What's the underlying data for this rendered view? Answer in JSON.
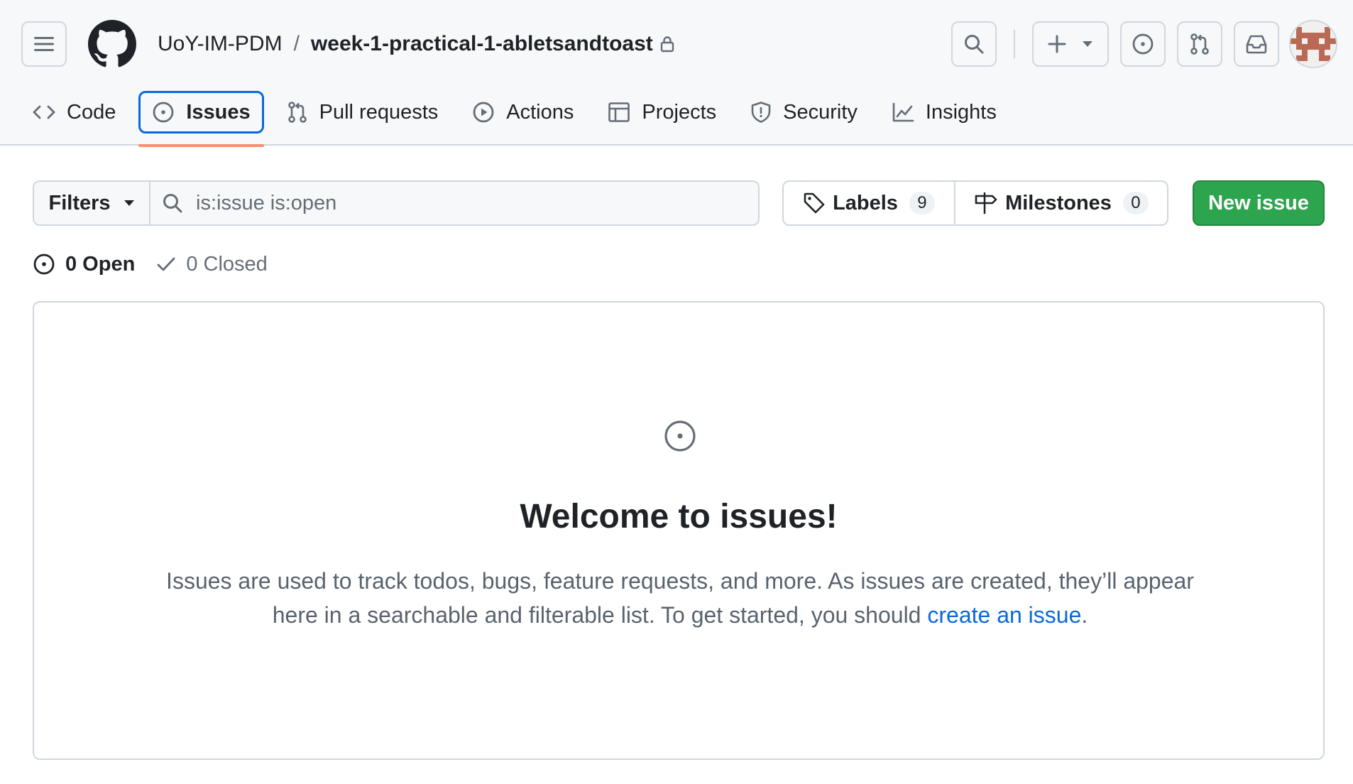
{
  "header": {
    "owner": "UoY-IM-PDM",
    "separator": "/",
    "repo": "week-1-practical-1-abletsandtoast"
  },
  "tabs": [
    {
      "label": "Code",
      "icon": "code-icon"
    },
    {
      "label": "Issues",
      "icon": "issue-opened-icon",
      "selected": true
    },
    {
      "label": "Pull requests",
      "icon": "git-pull-request-icon"
    },
    {
      "label": "Actions",
      "icon": "play-icon"
    },
    {
      "label": "Projects",
      "icon": "table-icon"
    },
    {
      "label": "Security",
      "icon": "shield-icon"
    },
    {
      "label": "Insights",
      "icon": "graph-icon"
    }
  ],
  "toolbar": {
    "filters_label": "Filters",
    "search_value": "is:issue is:open",
    "labels_label": "Labels",
    "labels_count": "9",
    "milestones_label": "Milestones",
    "milestones_count": "0",
    "new_issue_label": "New issue"
  },
  "states": {
    "open_label": "0 Open",
    "closed_label": "0 Closed"
  },
  "blankslate": {
    "title": "Welcome to issues!",
    "body_before_link": "Issues are used to track todos, bugs, feature requests, and more. As issues are created, they’ll appear here in a searchable and filterable list. To get started, you should ",
    "link_text": "create an issue",
    "body_after_link": "."
  },
  "colors": {
    "accent": "#0969da",
    "primary_button": "#2da44e",
    "selected_underline": "#fd8c73"
  }
}
